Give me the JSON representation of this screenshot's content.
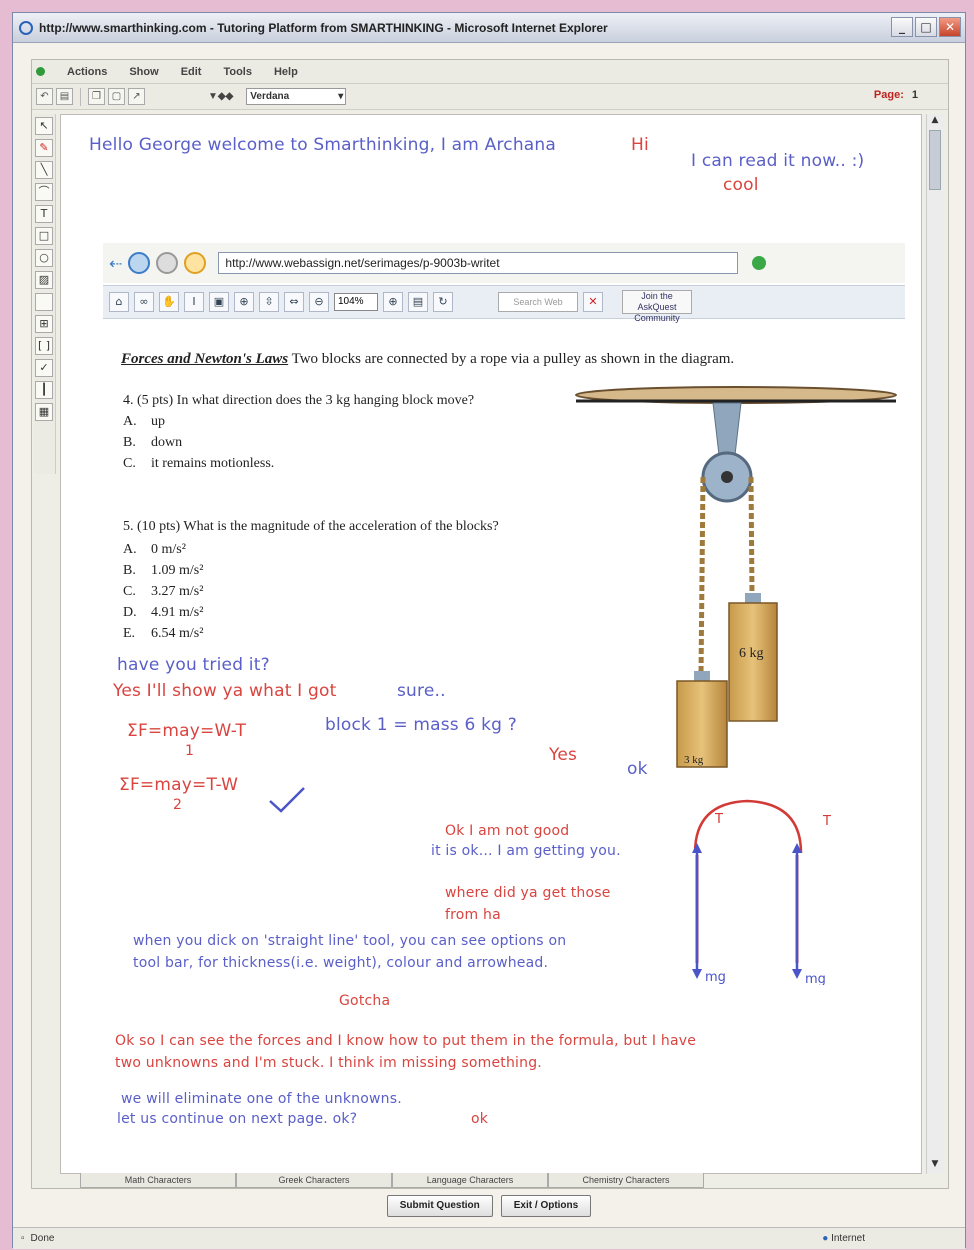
{
  "window": {
    "title": "http://www.smarthinking.com - Tutoring Platform from SMARTHINKING - Microsoft Internet Explorer",
    "min": "_",
    "max": "□",
    "close": "✕"
  },
  "menu": [
    "Actions",
    "Show",
    "Edit",
    "Tools",
    "Help"
  ],
  "toolbar": {
    "font_size": "▼◆◆",
    "font": "Verdana",
    "page_label": "Page:",
    "page_number": "1"
  },
  "chat": {
    "greeting": "Hello George welcome to Smarthinking, I am Archana",
    "hi": "Hi",
    "read_now": "I can read it now.. :)",
    "cool": "cool",
    "tried": "have you tried it?",
    "show_you": "Yes I'll show ya what I got",
    "sure": "sure..",
    "eq1": "ΣF=may=W-T",
    "eq1_sub": "1",
    "block1": "block 1 = mass 6 kg ?",
    "yes": "Yes",
    "ok1": "ok",
    "eq2": "ΣF=may=T-W",
    "eq2_sub": "2",
    "not_good": "Ok I am not good",
    "getting_you": "it is ok... I am getting you.",
    "where_from_1": "where did ya get those",
    "where_from_2": "from ha",
    "tool_explain_1": "when you dick on 'straight line' tool, you can see options on",
    "tool_explain_2": "tool bar, for thickness(i.e. weight), colour and arrowhead.",
    "gotcha": "Gotcha",
    "stuck_1": "Ok so I can see the forces and I know how to put them in the formula, but I have",
    "stuck_2": "two unknowns and I'm stuck.  I think im missing something.",
    "eliminate_1": "we will eliminate one of the unknowns.",
    "eliminate_2": "let us continue on next page.  ok?",
    "ok2": "ok"
  },
  "inner_browser": {
    "url": "http://www.webassign.net/serimages/p-9003b-writet",
    "zoom": "104%",
    "search": "Search Web",
    "right_btn": "Join the AskQuest Community"
  },
  "problem": {
    "topic": "Forces and Newton's Laws",
    "intro": "Two blocks are connected by a rope via a pulley as shown in the diagram.",
    "q4": "4. (5 pts)  In what direction does the 3 kg hanging block move?",
    "q4_options": [
      {
        "letter": "A.",
        "text": "up"
      },
      {
        "letter": "B.",
        "text": "down"
      },
      {
        "letter": "C.",
        "text": "it remains motionless."
      }
    ],
    "q5": "5. (10 pts)  What is the magnitude of the acceleration of the blocks?",
    "q5_options": [
      {
        "letter": "A.",
        "text": "0 m/s²"
      },
      {
        "letter": "B.",
        "text": "1.09 m/s²"
      },
      {
        "letter": "C.",
        "text": "3.27 m/s²"
      },
      {
        "letter": "D.",
        "text": "4.91 m/s²"
      },
      {
        "letter": "E.",
        "text": "6.54 m/s²"
      }
    ]
  },
  "diagram": {
    "block_big": "6 kg",
    "block_small": "3 kg",
    "tension": "T",
    "weight": "mg"
  },
  "palette_tabs": [
    "Math Characters",
    "Greek Characters",
    "Language Characters",
    "Chemistry Characters"
  ],
  "buttons": {
    "submit": "Submit Question",
    "exit": "Exit / Options"
  },
  "status": {
    "left": "Done",
    "right": "Internet"
  }
}
